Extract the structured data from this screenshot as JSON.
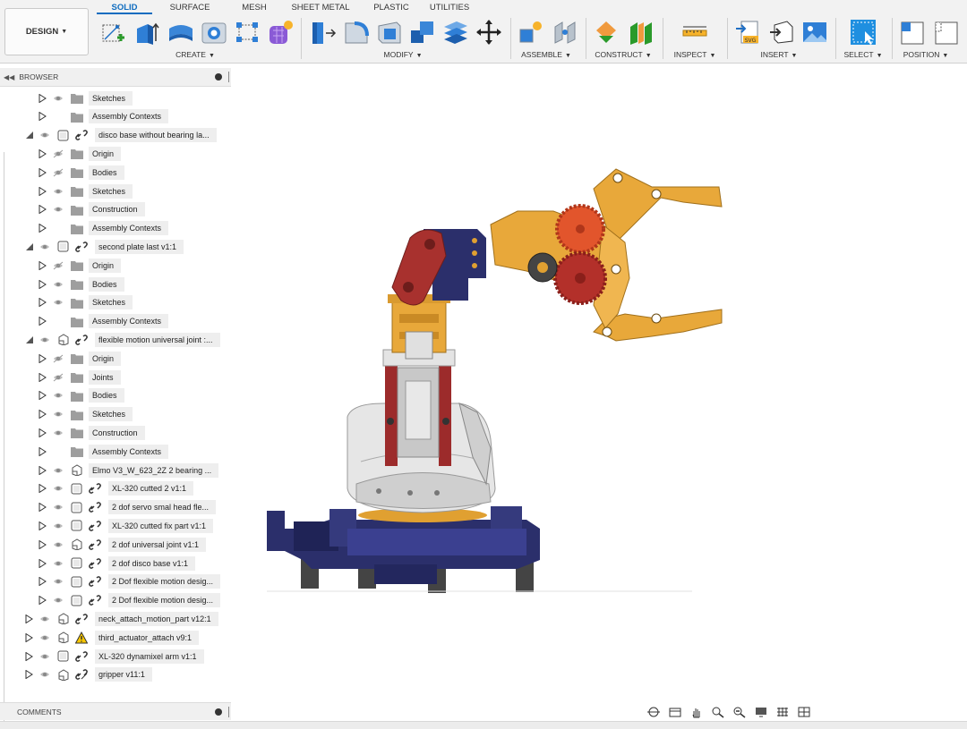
{
  "workspace": {
    "design_label": "DESIGN"
  },
  "tabs": [
    {
      "label": "SOLID",
      "active": true
    },
    {
      "label": "SURFACE",
      "active": false
    },
    {
      "label": "MESH",
      "active": false
    },
    {
      "label": "SHEET METAL",
      "active": false
    },
    {
      "label": "PLASTIC",
      "active": false
    },
    {
      "label": "UTILITIES",
      "active": false
    }
  ],
  "groups": {
    "create": "CREATE",
    "modify": "MODIFY",
    "assemble": "ASSEMBLE",
    "construct": "CONSTRUCT",
    "inspect": "INSPECT",
    "insert": "INSERT",
    "select": "SELECT",
    "position": "POSITION"
  },
  "browser": {
    "title": "BROWSER",
    "items": [
      {
        "label": "Sketches",
        "kind": "folder",
        "level": 2,
        "eye": "on"
      },
      {
        "label": "Assembly Contexts",
        "kind": "folder",
        "level": 2,
        "eye": "none"
      },
      {
        "label": "disco base without bearing la...",
        "kind": "component",
        "level": 1,
        "expanded": true,
        "eye": "on",
        "link": "link"
      },
      {
        "label": "Origin",
        "kind": "folder",
        "level": 2,
        "eye": "off"
      },
      {
        "label": "Bodies",
        "kind": "folder",
        "level": 2,
        "eye": "off"
      },
      {
        "label": "Sketches",
        "kind": "folder",
        "level": 2,
        "eye": "on"
      },
      {
        "label": "Construction",
        "kind": "folder",
        "level": 2,
        "eye": "on"
      },
      {
        "label": "Assembly Contexts",
        "kind": "folder",
        "level": 2,
        "eye": "none"
      },
      {
        "label": "second plate last v1:1",
        "kind": "component",
        "level": 1,
        "expanded": true,
        "eye": "on",
        "link": "link"
      },
      {
        "label": "Origin",
        "kind": "folder",
        "level": 2,
        "eye": "off"
      },
      {
        "label": "Bodies",
        "kind": "folder",
        "level": 2,
        "eye": "on"
      },
      {
        "label": "Sketches",
        "kind": "folder",
        "level": 2,
        "eye": "on"
      },
      {
        "label": "Assembly Contexts",
        "kind": "folder",
        "level": 2,
        "eye": "none"
      },
      {
        "label": "flexible motion universal joint :...",
        "kind": "assembly",
        "level": 1,
        "expanded": true,
        "eye": "on",
        "link": "link"
      },
      {
        "label": "Origin",
        "kind": "folder",
        "level": 2,
        "eye": "off"
      },
      {
        "label": "Joints",
        "kind": "folder",
        "level": 2,
        "eye": "off"
      },
      {
        "label": "Bodies",
        "kind": "folder",
        "level": 2,
        "eye": "on"
      },
      {
        "label": "Sketches",
        "kind": "folder",
        "level": 2,
        "eye": "on"
      },
      {
        "label": "Construction",
        "kind": "folder",
        "level": 2,
        "eye": "on"
      },
      {
        "label": "Assembly Contexts",
        "kind": "folder",
        "level": 2,
        "eye": "none"
      },
      {
        "label": "Elmo V3_W_623_2Z 2 bearing ...",
        "kind": "assembly",
        "level": 2,
        "eye": "on",
        "link": "none"
      },
      {
        "label": "XL-320 cutted 2 v1:1",
        "kind": "component",
        "level": 2,
        "eye": "on",
        "link": "link"
      },
      {
        "label": "2 dof servo smal head fle...",
        "kind": "component",
        "level": 2,
        "eye": "on",
        "link": "link"
      },
      {
        "label": "XL-320 cutted fix part v1:1",
        "kind": "component",
        "level": 2,
        "eye": "on",
        "link": "link"
      },
      {
        "label": "2 dof universal joint v1:1",
        "kind": "assembly",
        "level": 2,
        "eye": "on",
        "link": "link"
      },
      {
        "label": "2 dof disco base v1:1",
        "kind": "component",
        "level": 2,
        "eye": "on",
        "link": "link"
      },
      {
        "label": "2 Dof flexible motion desig...",
        "kind": "component",
        "level": 2,
        "eye": "on",
        "link": "link"
      },
      {
        "label": "2 Dof flexible motion desig...",
        "kind": "component",
        "level": 2,
        "eye": "on",
        "link": "link"
      },
      {
        "label": "neck_attach_motion_part v12:1",
        "kind": "assembly",
        "level": 1,
        "eye": "on",
        "link": "link"
      },
      {
        "label": "third_actuator_attach v9:1",
        "kind": "assembly",
        "level": 1,
        "eye": "on",
        "link": "warning"
      },
      {
        "label": "XL-320 dynamixel arm v1:1",
        "kind": "component",
        "level": 1,
        "eye": "on",
        "link": "link"
      },
      {
        "label": "gripper v11:1",
        "kind": "assembly",
        "level": 1,
        "eye": "on",
        "link": "link-edit"
      }
    ]
  },
  "comments": {
    "title": "COMMENTS"
  },
  "navbar": {
    "icons": [
      "orbit-icon",
      "look-at-icon",
      "pan-icon",
      "zoom-window-icon",
      "zoom-icon",
      "display-settings-icon",
      "grid-icon",
      "viewports-icon"
    ]
  },
  "colors": {
    "accent": "#0f6cbf",
    "gear": "#e2552c",
    "frame": "#e8a83a",
    "base": "#2b2f6b",
    "shell": "#e6e6e6"
  }
}
